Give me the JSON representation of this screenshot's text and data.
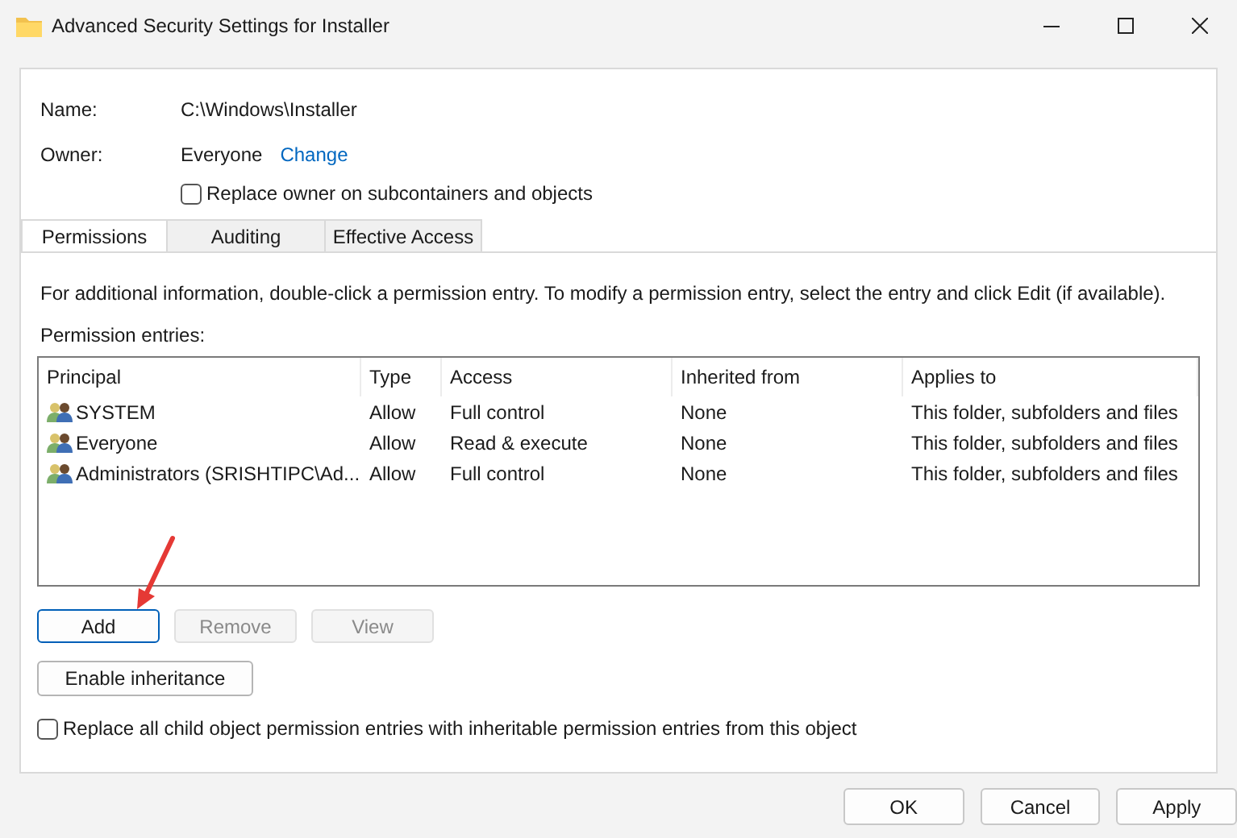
{
  "window": {
    "title": "Advanced Security Settings for Installer"
  },
  "name": {
    "label": "Name:",
    "value": "C:\\Windows\\Installer"
  },
  "owner": {
    "label": "Owner:",
    "value": "Everyone",
    "link": "Change"
  },
  "replace_owner": {
    "label": "Replace owner on subcontainers and objects",
    "checked": false
  },
  "tabs": [
    {
      "label": "Permissions",
      "selected": true
    },
    {
      "label": "Auditing",
      "selected": false
    },
    {
      "label": "Effective Access",
      "selected": false
    }
  ],
  "info_text": "For additional information, double-click a permission entry. To modify a permission entry, select the entry and click Edit (if available).",
  "entries_label": "Permission entries:",
  "table": {
    "columns": [
      "Principal",
      "Type",
      "Access",
      "Inherited from",
      "Applies to"
    ],
    "rows": [
      [
        "SYSTEM",
        "Allow",
        "Full control",
        "None",
        "This folder, subfolders and files"
      ],
      [
        "Everyone",
        "Allow",
        "Read & execute",
        "None",
        "This folder, subfolders and files"
      ],
      [
        "Administrators (SRISHTIPC\\Ad...",
        "Allow",
        "Full control",
        "None",
        "This folder, subfolders and files"
      ]
    ]
  },
  "entry_buttons": [
    {
      "label": "Add",
      "disabled": false,
      "focused": true
    },
    {
      "label": "Remove",
      "disabled": true,
      "focused": false
    },
    {
      "label": "View",
      "disabled": true,
      "focused": false
    }
  ],
  "enable_inheritance": "Enable inheritance",
  "replace_child": {
    "label": "Replace all child object permission entries with inheritable permission entries from this object",
    "checked": false
  },
  "footer_buttons": [
    {
      "label": "OK"
    },
    {
      "label": "Cancel"
    },
    {
      "label": "Apply"
    }
  ]
}
